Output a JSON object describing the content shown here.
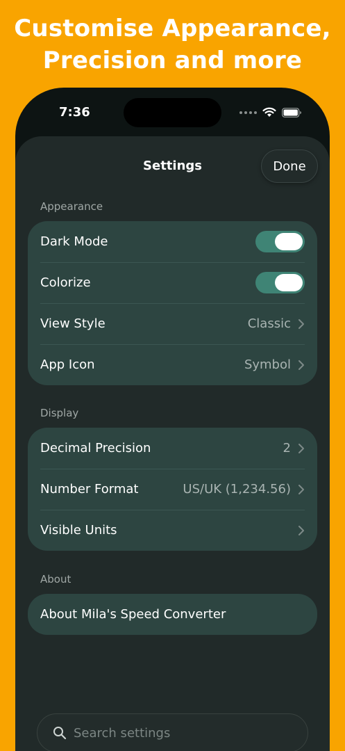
{
  "headline": {
    "line1": "Customise Appearance,",
    "line2": "Precision and more"
  },
  "status_bar": {
    "time": "7:36"
  },
  "sheet": {
    "title": "Settings",
    "done_label": "Done"
  },
  "appearance": {
    "section_label": "Appearance",
    "dark_mode": {
      "label": "Dark Mode",
      "on": true
    },
    "colorize": {
      "label": "Colorize",
      "on": true
    },
    "view_style": {
      "label": "View Style",
      "value": "Classic"
    },
    "app_icon": {
      "label": "App Icon",
      "value": "Symbol"
    }
  },
  "display": {
    "section_label": "Display",
    "decimal_precision": {
      "label": "Decimal Precision",
      "value": "2"
    },
    "number_format": {
      "label": "Number Format",
      "value": "US/UK (1,234.56)"
    },
    "visible_units": {
      "label": "Visible Units"
    }
  },
  "about": {
    "section_label": "About",
    "about_app": {
      "label": "About Mila's Speed Converter"
    }
  },
  "search": {
    "placeholder": "Search settings"
  },
  "colors": {
    "background": "#F9A400",
    "sheet": "#212a29",
    "card": "#2d4541",
    "toggle_on": "#3f8475"
  },
  "icons": [
    "signal-dots-icon",
    "wifi-icon",
    "battery-icon",
    "chevron-right-icon",
    "search-icon"
  ]
}
